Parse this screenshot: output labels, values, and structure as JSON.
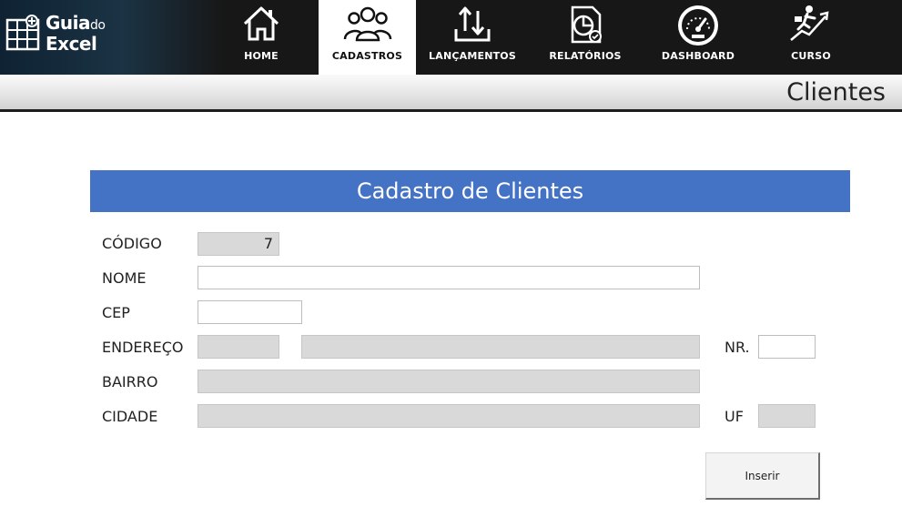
{
  "brand": {
    "line1": "Guia",
    "line1_small": "do",
    "line2": "Excel",
    "icon": "spreadsheet-logo-icon"
  },
  "nav": {
    "items": [
      {
        "label": "HOME",
        "icon": "house-icon"
      },
      {
        "label": "CADASTROS",
        "icon": "users-group-icon",
        "active": true
      },
      {
        "label": "LANÇAMENTOS",
        "icon": "transfer-arrows-icon"
      },
      {
        "label": "RELATÓRIOS",
        "icon": "report-chart-icon"
      },
      {
        "label": "DASHBOARD",
        "icon": "speedometer-icon"
      },
      {
        "label": "CURSO",
        "icon": "runner-growth-icon"
      }
    ]
  },
  "page": {
    "title": "Clientes"
  },
  "form": {
    "title": "Cadastro de Clientes",
    "labels": {
      "codigo": "CÓDIGO",
      "nome": "NOME",
      "cep": "CEP",
      "endereco": "ENDEREÇO",
      "nr": "NR.",
      "bairro": "BAIRRO",
      "cidade": "CIDADE",
      "uf": "UF"
    },
    "values": {
      "codigo": "7",
      "nome": "",
      "cep": "",
      "endereco_tipo": "",
      "endereco": "",
      "nr": "",
      "bairro": "",
      "cidade": "",
      "uf": ""
    },
    "submit_label": "Inserir"
  },
  "colors": {
    "nav_bg": "#171717",
    "banner_bg": "#4472c4",
    "readonly_bg": "#d9d9d9"
  }
}
